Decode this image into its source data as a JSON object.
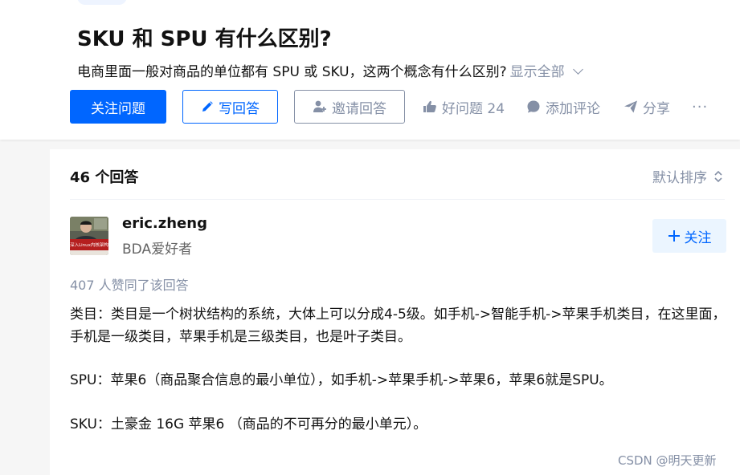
{
  "question": {
    "title": "SKU 和 SPU 有什么区别?",
    "detail": "电商里面一般对商品的单位都有 SPU 或 SKU，这两个概念有什么区别?",
    "show_all": "显示全部"
  },
  "actions": {
    "follow_question": "关注问题",
    "write_answer": "写回答",
    "invite_answer": "邀请回答",
    "good_question": "好问题 24",
    "add_comment": "添加评论",
    "share": "分享",
    "more": "···"
  },
  "answers": {
    "count_label": "46 个回答",
    "sort_label": "默认排序"
  },
  "answer": {
    "author": {
      "name": "eric.zheng",
      "bio": "BDA爱好者",
      "avatar_caption": "深入Linux内核架构"
    },
    "follow_label": "关注",
    "votes": "407 人赞同了该回答",
    "paragraphs": [
      "类目：类目是一个树状结构的系统，大体上可以分成4-5级。如手机->智能手机->苹果手机类目，在这里面，手机是一级类目，苹果手机是三级类目，也是叶子类目。",
      "SPU：苹果6（商品聚合信息的最小单位），如手机->苹果手机->苹果6，苹果6就是SPU。",
      "SKU：土豪金 16G 苹果6 （商品的不可再分的最小单元）。"
    ]
  },
  "watermark": "CSDN @明天更新",
  "colors": {
    "brand_blue": "#0066ff",
    "muted_gray": "#8590a6",
    "follow_bg": "#ebf5ff"
  }
}
